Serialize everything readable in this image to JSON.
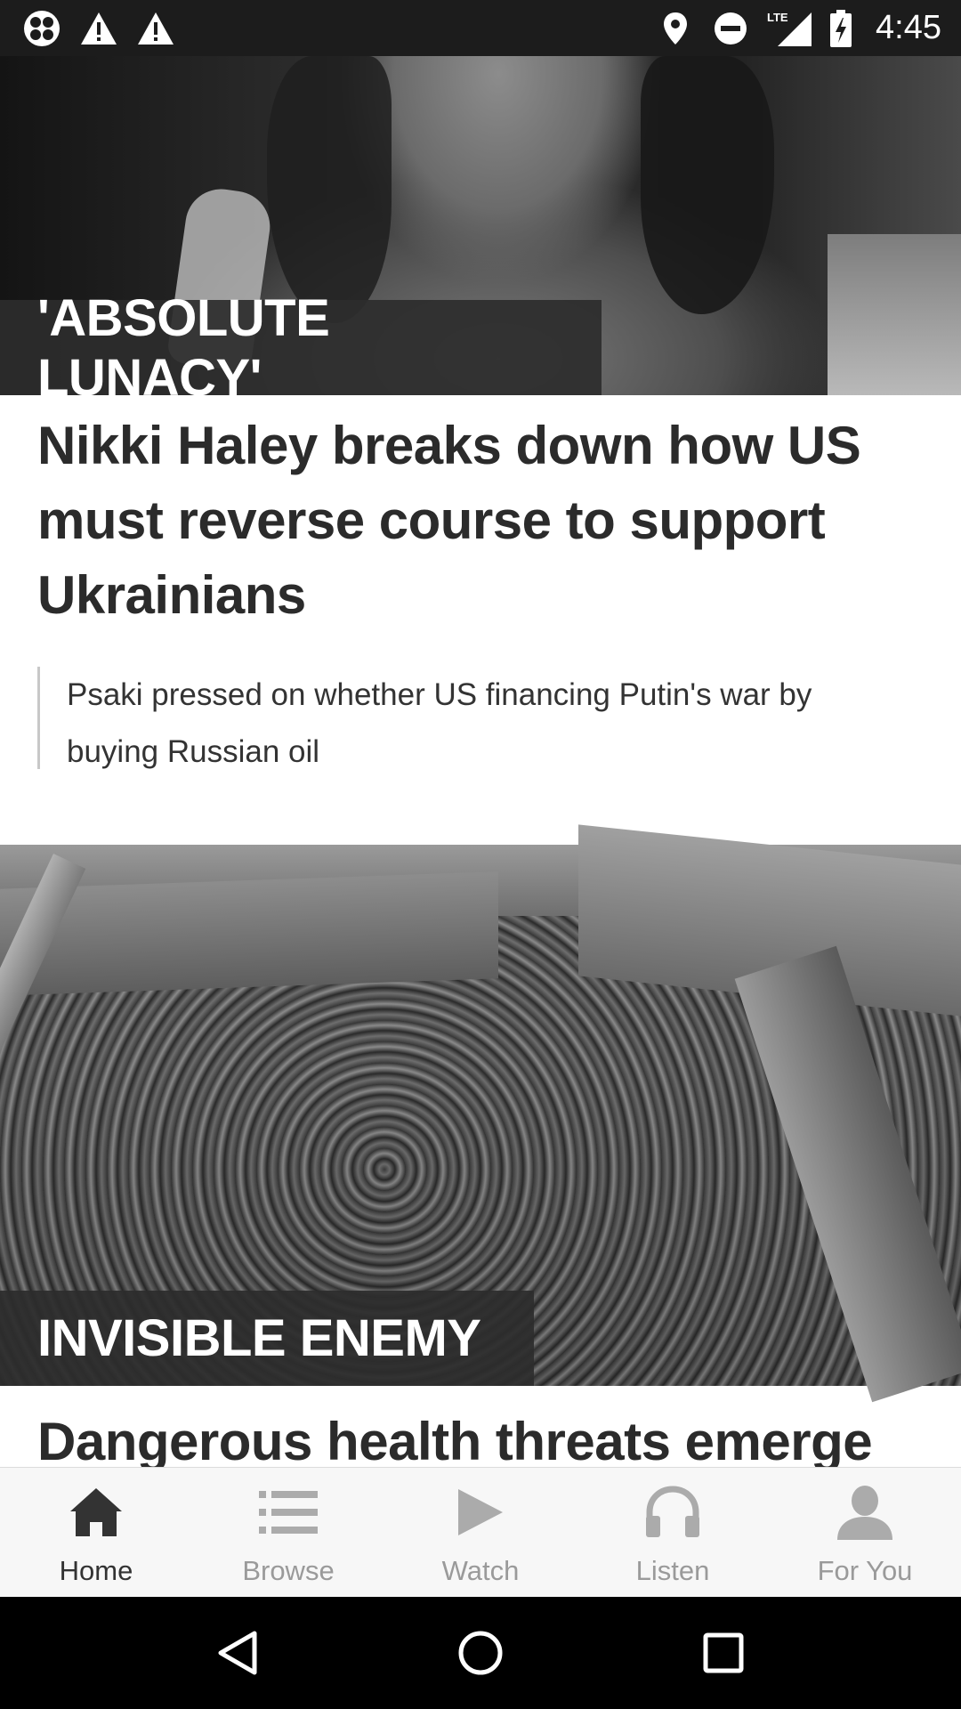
{
  "status_bar": {
    "time": "4:45",
    "network": "LTE",
    "left_icons": [
      "app-notification-icon",
      "warning-icon",
      "warning-icon"
    ],
    "right_icons": [
      "location-icon",
      "do-not-disturb-icon",
      "lte-signal-icon",
      "battery-charging-icon"
    ]
  },
  "feed": {
    "stories": [
      {
        "kicker": "'ABSOLUTE LUNACY'",
        "headline": "Nikki Haley breaks down how US must reverse course to support Ukrainians",
        "related": "Psaki pressed on whether US financing Putin's war by buying Russian oil"
      },
      {
        "kicker": "INVISIBLE ENEMY",
        "headline": "Dangerous health threats emerge"
      }
    ]
  },
  "bottom_nav": {
    "items": [
      {
        "label": "Home",
        "icon": "home-icon",
        "active": true
      },
      {
        "label": "Browse",
        "icon": "list-icon",
        "active": false
      },
      {
        "label": "Watch",
        "icon": "play-icon",
        "active": false
      },
      {
        "label": "Listen",
        "icon": "headphones-icon",
        "active": false
      },
      {
        "label": "For You",
        "icon": "person-icon",
        "active": false
      }
    ]
  },
  "system_nav": [
    "back-icon",
    "home-circle-icon",
    "recents-icon"
  ],
  "colors": {
    "status_bar_bg": "#1c1c1c",
    "kicker_bg": "#2d2d2d",
    "headline_text": "#2b2b2b",
    "nav_active": "#333333",
    "nav_inactive": "#9a9a9a"
  }
}
